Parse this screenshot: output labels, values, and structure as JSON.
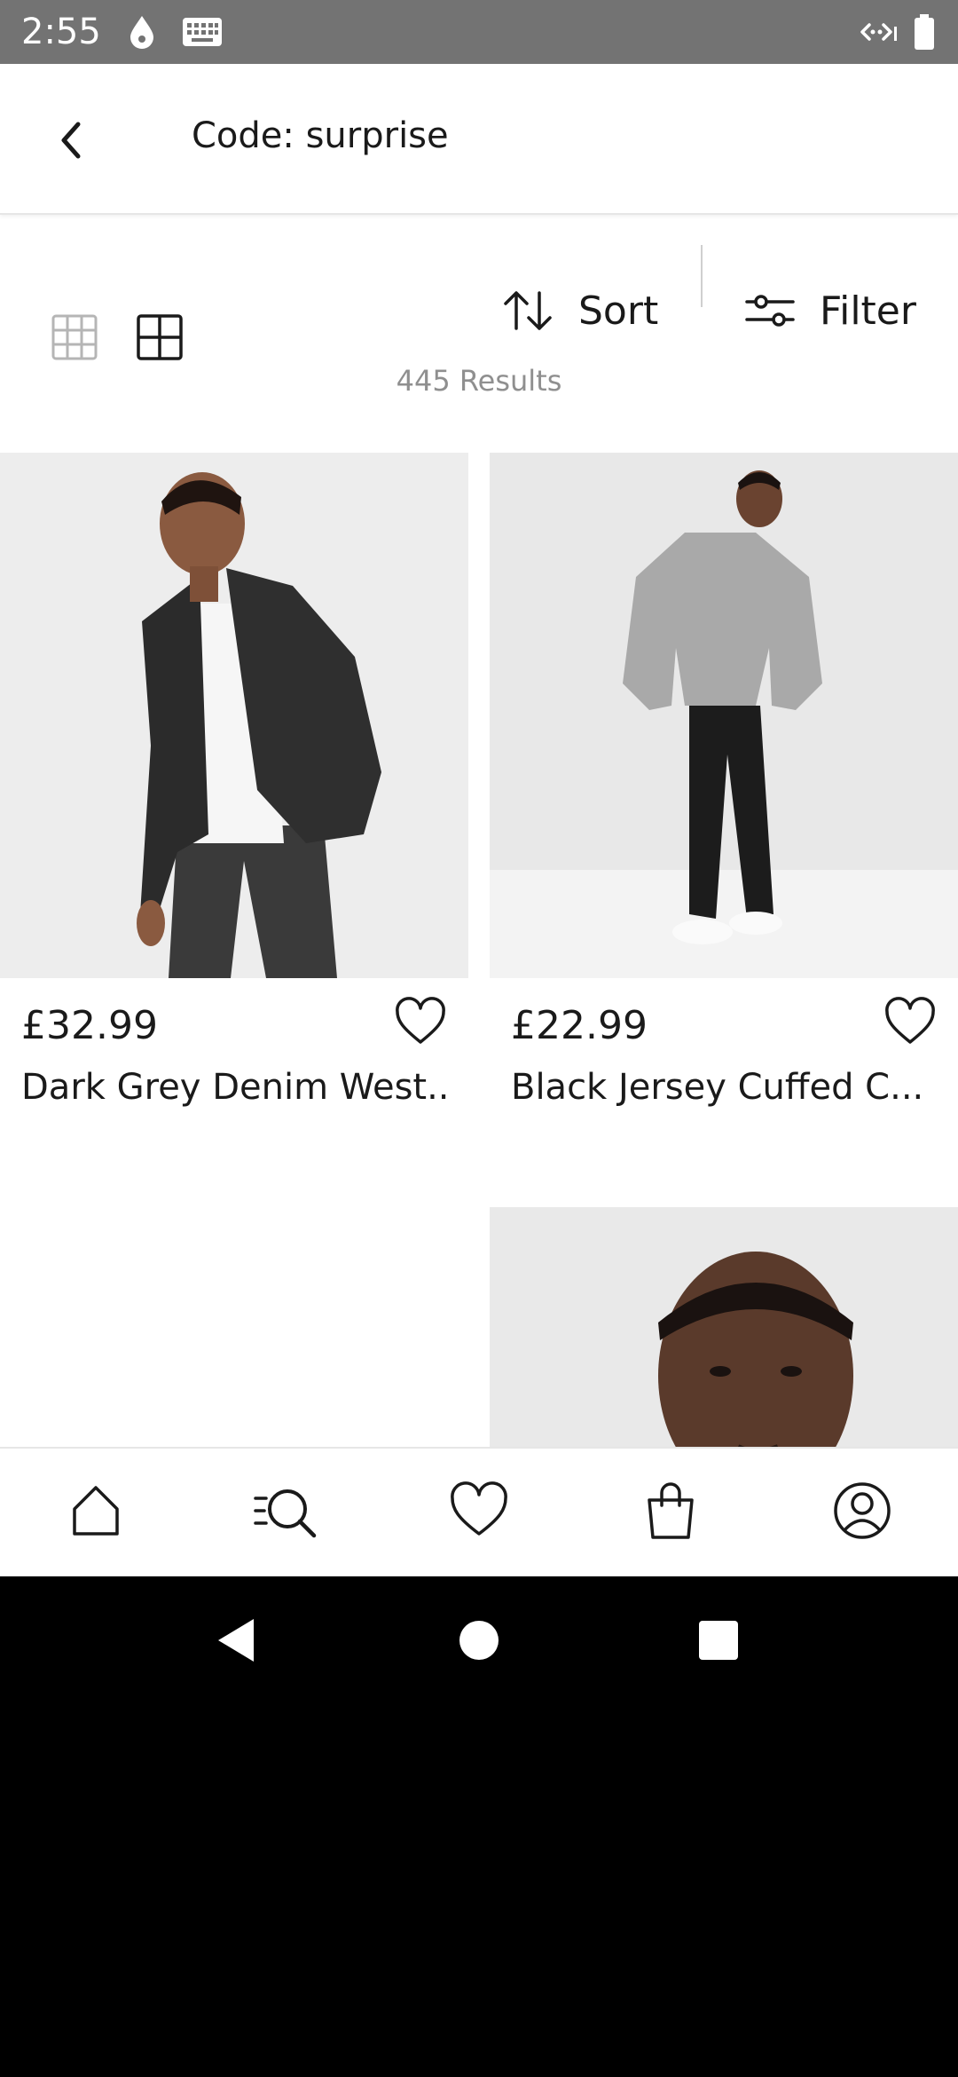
{
  "status_bar": {
    "time": "2:55",
    "icons": [
      "drop-icon",
      "keyboard-icon",
      "cast-icon",
      "battery-icon"
    ]
  },
  "header": {
    "title": "Code: surprise",
    "back_icon": "chevron-left-icon"
  },
  "toolbar": {
    "view_options": [
      "grid-3x3-icon",
      "grid-2x2-icon"
    ],
    "selected_view": "grid-2x2-icon",
    "sort_label": "Sort",
    "filter_label": "Filter"
  },
  "results": {
    "count_text": "445 Results"
  },
  "products": [
    {
      "price": "£32.99",
      "name": "Dark Grey Denim West...",
      "image": "man-in-black-denim-jacket"
    },
    {
      "price": "£22.99",
      "name": "Black Jersey Cuffed C...",
      "image": "man-in-grey-sweatshirt-black-joggers"
    },
    {
      "price": "",
      "name": "",
      "image": ""
    },
    {
      "price": "",
      "name": "",
      "image": "man-portrait-closeup"
    }
  ],
  "bottom_nav": {
    "items": [
      "home-icon",
      "search-list-icon",
      "heart-icon",
      "bag-icon",
      "profile-icon"
    ]
  },
  "system_nav": {
    "items": [
      "back-triangle-icon",
      "home-circle-icon",
      "recents-square-icon"
    ]
  },
  "colors": {
    "status_bar": "#737373",
    "text_primary": "#1a1a1a",
    "text_muted": "#8f8f8f",
    "divider": "#e6e6e6"
  }
}
